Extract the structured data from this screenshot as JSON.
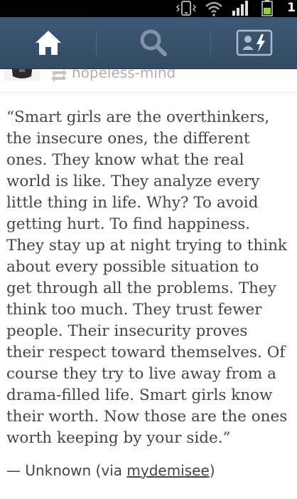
{
  "status_bar": {
    "time": "1",
    "icons": [
      "vibrate-icon",
      "wifi-icon",
      "signal-icon",
      "battery-icon"
    ]
  },
  "nav": {
    "items": [
      "home-icon",
      "search-icon",
      "account-icon"
    ]
  },
  "post": {
    "reblogged_from": "hopeless-mind",
    "quote_lines": [
      "“Smart girls are the overthinkers,",
      "the insecure ones, the different",
      "ones. They know what the real",
      "world is like. They analyze every",
      "little thing in life. Why? To avoid",
      "getting hurt. To find happiness.",
      "They stay up at night trying to think",
      "about every possible situation to",
      "get through all the problems. They",
      "think too much. They trust fewer",
      "people. Their insecurity proves",
      "their respect toward themselves. Of",
      "course they try to live away from a",
      "drama-filled life. Smart girls know",
      "their worth. Now those are the ones",
      "worth keeping by your side.”"
    ],
    "source_prefix": "— Unknown (via ",
    "source_link": "mydemisee",
    "source_suffix": ")"
  },
  "colors": {
    "nav_bg": "#35506a",
    "text": "#444444",
    "muted": "#b0b0b0"
  }
}
